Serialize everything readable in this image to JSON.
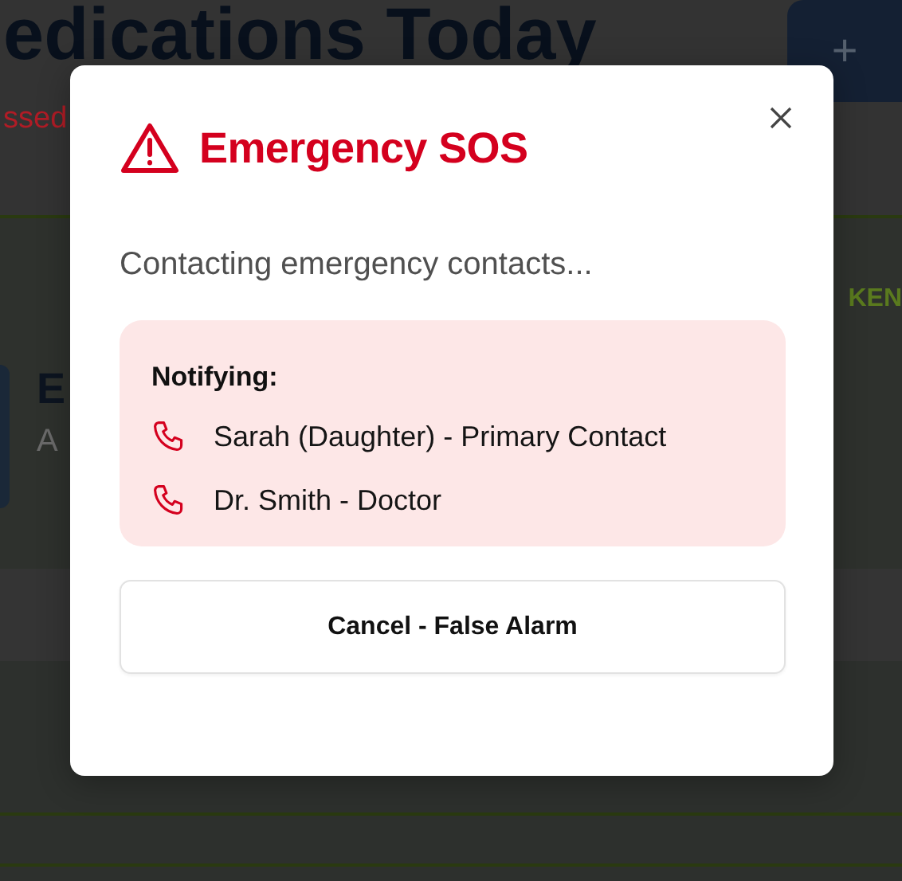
{
  "background": {
    "title": "edications Today",
    "missed_text": "ssed",
    "add_button": "+",
    "taken_text": "KEN",
    "med_initial": "E",
    "med_detail": "A"
  },
  "dialog": {
    "title": "Emergency SOS",
    "message": "Contacting emergency contacts...",
    "notify": {
      "heading": "Notifying:",
      "contacts": [
        {
          "name": "Sarah (Daughter) - Primary Contact"
        },
        {
          "name": "Dr. Smith - Doctor"
        }
      ]
    },
    "cancel_button": "Cancel - False Alarm"
  }
}
